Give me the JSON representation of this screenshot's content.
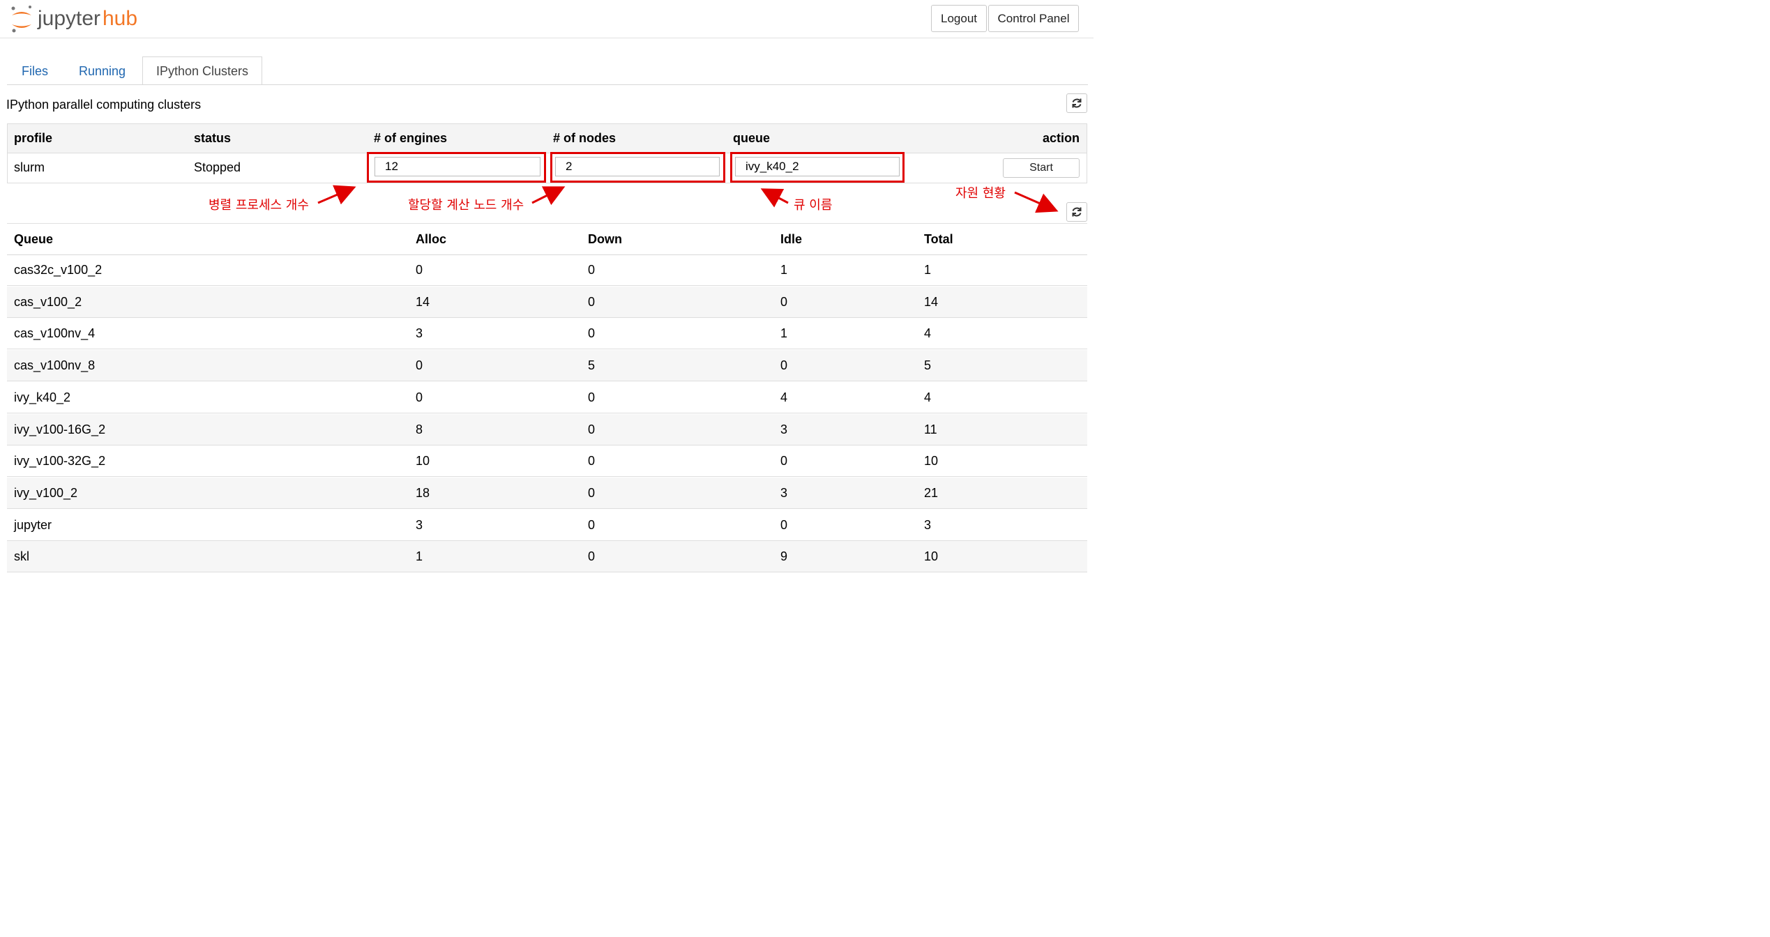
{
  "header": {
    "logo_text_a": "jupyter",
    "logo_text_b": "hub",
    "logout_label": "Logout",
    "control_panel_label": "Control Panel",
    "brand_orange": "#f37726"
  },
  "tabs": [
    {
      "label": "Files"
    },
    {
      "label": "Running"
    },
    {
      "label": "IPython Clusters"
    }
  ],
  "clusters": {
    "title": "IPython parallel computing clusters",
    "columns": [
      "profile",
      "status",
      "# of engines",
      "# of nodes",
      "queue",
      "action"
    ],
    "row": {
      "profile": "slurm",
      "status": "Stopped",
      "engines": "12",
      "nodes": "2",
      "queue": "ivy_k40_2",
      "action_label": "Start"
    }
  },
  "annotations": {
    "engines": "병렬 프로세스 개수",
    "nodes": "할당할 계산 노드 개수",
    "queue": "큐 이름",
    "resources": "자원 현황",
    "color": "#e00000"
  },
  "queues": {
    "columns": [
      "Queue",
      "Alloc",
      "Down",
      "Idle",
      "Total"
    ],
    "rows": [
      [
        "cas32c_v100_2",
        "0",
        "0",
        "1",
        "1"
      ],
      [
        "cas_v100_2",
        "14",
        "0",
        "0",
        "14"
      ],
      [
        "cas_v100nv_4",
        "3",
        "0",
        "1",
        "4"
      ],
      [
        "cas_v100nv_8",
        "0",
        "5",
        "0",
        "5"
      ],
      [
        "ivy_k40_2",
        "0",
        "0",
        "4",
        "4"
      ],
      [
        "ivy_v100-16G_2",
        "8",
        "0",
        "3",
        "11"
      ],
      [
        "ivy_v100-32G_2",
        "10",
        "0",
        "0",
        "10"
      ],
      [
        "ivy_v100_2",
        "18",
        "0",
        "3",
        "21"
      ],
      [
        "jupyter",
        "3",
        "0",
        "0",
        "3"
      ],
      [
        "skl",
        "1",
        "0",
        "9",
        "10"
      ]
    ]
  }
}
